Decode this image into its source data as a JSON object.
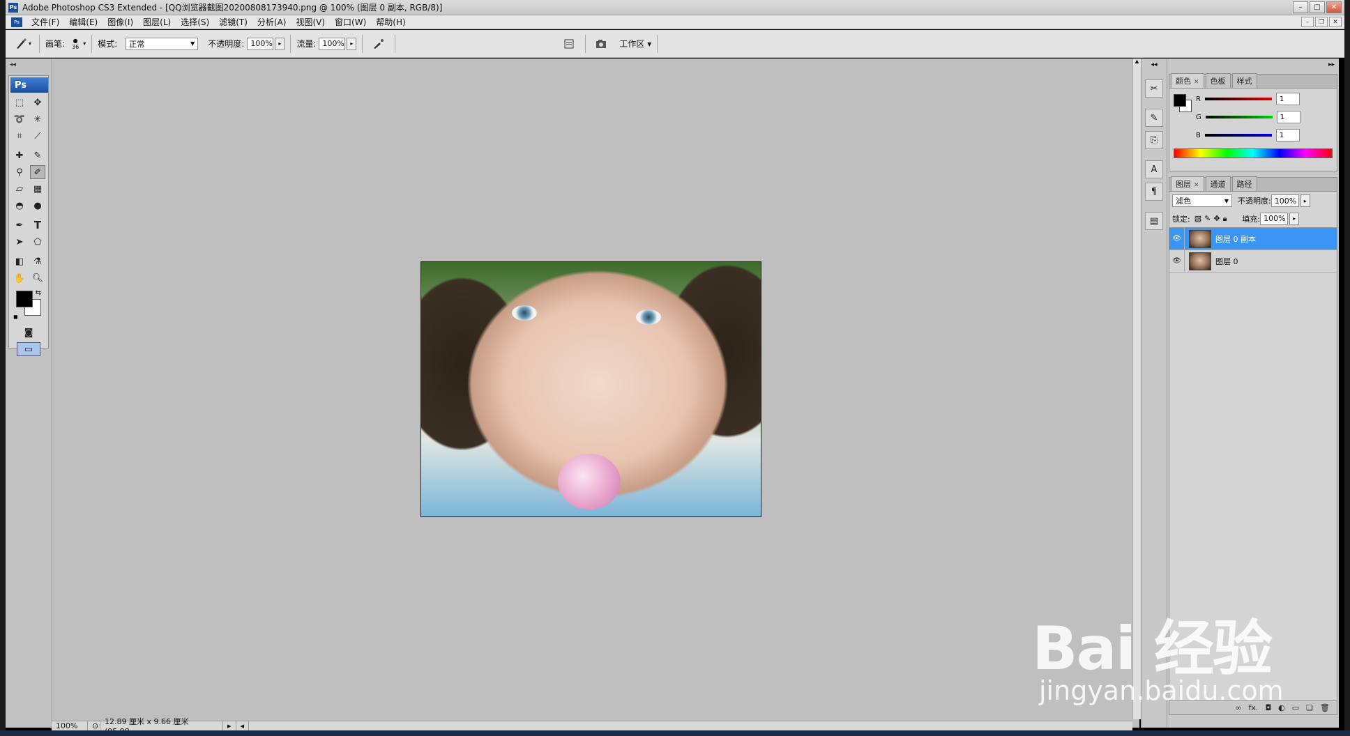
{
  "window": {
    "title": "Adobe Photoshop CS3 Extended - [QQ浏览器截图20200808173940.png @ 100% (图层 0 副本, RGB/8)]",
    "app_badge": "Ps",
    "controls": [
      "–",
      "□",
      "✕"
    ]
  },
  "menubar": {
    "doc_badge": "Ps",
    "items": [
      "文件(F)",
      "编辑(E)",
      "图像(I)",
      "图层(L)",
      "选择(S)",
      "滤镜(T)",
      "分析(A)",
      "视图(V)",
      "窗口(W)",
      "帮助(H)"
    ],
    "mdi_controls": [
      "–",
      "❐",
      "✕"
    ]
  },
  "options": {
    "brush_label": "画笔:",
    "brush_size": "36",
    "mode_label": "模式:",
    "mode_value": "正常",
    "opacity_label": "不透明度:",
    "opacity_value": "100%",
    "flow_label": "流量:",
    "flow_value": "100%",
    "workspace_label": "工作区 ▾"
  },
  "toolbox": {
    "logo": "Ps"
  },
  "status": {
    "zoom": "100%",
    "doc_info": "12.89 厘米 x 9.66 厘米 (95.98..."
  },
  "color_panel": {
    "tabs": [
      "颜色",
      "色板",
      "样式"
    ],
    "channels": [
      {
        "label": "R",
        "value": "1",
        "color": "#d20000"
      },
      {
        "label": "G",
        "value": "1",
        "color": "#00b000"
      },
      {
        "label": "B",
        "value": "1",
        "color": "#0000c8"
      }
    ]
  },
  "layers_panel": {
    "tabs": [
      "图层",
      "通道",
      "路径"
    ],
    "blend_mode": "滤色",
    "opacity_label": "不透明度:",
    "opacity_value": "100%",
    "lock_label": "锁定:",
    "fill_label": "填充:",
    "fill_value": "100%",
    "layers": [
      {
        "name": "图层 0 副本",
        "selected": true
      },
      {
        "name": "图层 0",
        "selected": false
      }
    ],
    "footer_icons": [
      "∞",
      "fx.",
      "◘",
      "◐",
      "▭",
      "❏",
      "🗑"
    ]
  },
  "watermark": {
    "logo": "Bai 经验",
    "url": "jingyan.baidu.com"
  },
  "colors": {
    "selection": "#3b95f5",
    "workspace_bg": "#bfbfbf"
  }
}
